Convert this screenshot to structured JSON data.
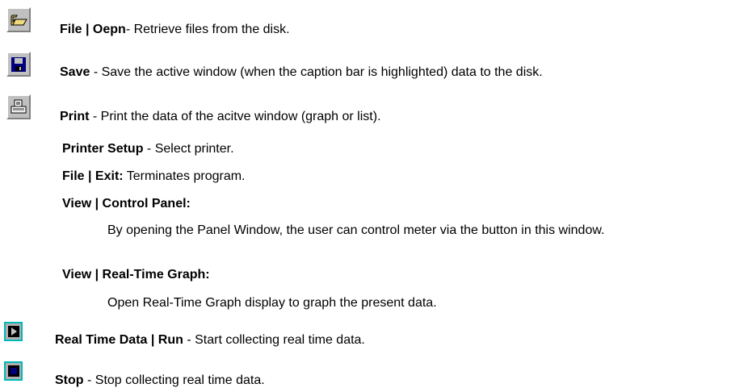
{
  "items": {
    "open": {
      "title": "File | Oepn",
      "desc": "- Retrieve files from the disk."
    },
    "save": {
      "title": "Save",
      "desc": " - Save the active window (when the caption bar is highlighted) data to the disk."
    },
    "print": {
      "title": "Print",
      "desc": " - Print the data of the acitve window (graph or list)."
    },
    "printer_setup": {
      "title": "Printer Setup",
      "desc": " - Select printer."
    },
    "exit": {
      "title": "File | Exit:",
      "desc": " Terminates program."
    },
    "control_panel": {
      "title": "View | Control Panel:",
      "desc": "By opening the Panel Window, the user can control meter via the button in this window."
    },
    "realtime_graph": {
      "title": "View | Real-Time Graph:",
      "desc": "Open Real-Time Graph display to graph the present data."
    },
    "run": {
      "title": "Real Time Data | Run",
      "desc": " - Start collecting real time data."
    },
    "stop": {
      "title": "Stop",
      "desc": " - Stop collecting real time data."
    }
  },
  "icons": {
    "open": "folder-open-icon",
    "save": "floppy-disk-icon",
    "print": "printer-icon",
    "run": "play-icon",
    "stop": "stop-icon"
  },
  "colors": {
    "icon_face": "#c0c0c0",
    "toolbar_border": "#00b8b8",
    "folder": "#e6c75a",
    "disk": "#000080",
    "stop_square": "#000080"
  }
}
